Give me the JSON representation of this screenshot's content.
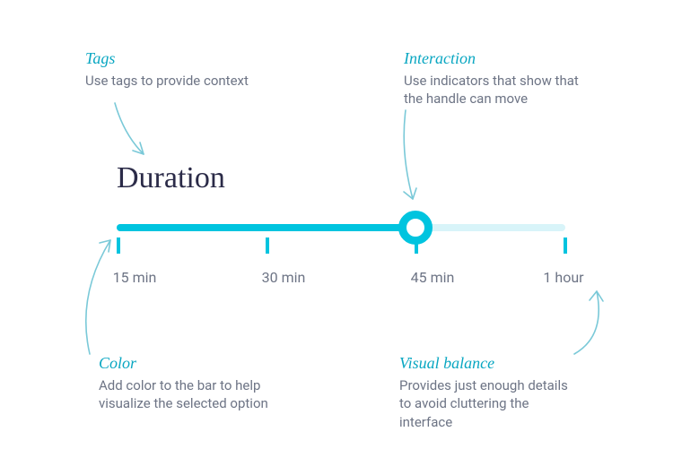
{
  "slider": {
    "title": "Duration",
    "ticks": [
      "15 min",
      "30 min",
      "45 min",
      "1 hour"
    ],
    "selected_index": 2
  },
  "callouts": {
    "tags": {
      "title": "Tags",
      "body": "Use tags to provide context"
    },
    "interaction": {
      "title": "Interaction",
      "body": "Use indicators that show that the handle can move"
    },
    "color": {
      "title": "Color",
      "body": "Add color to the bar to help visualize the selected option"
    },
    "balance": {
      "title": "Visual balance",
      "body": "Provides just enough details to avoid cluttering the interface"
    }
  }
}
